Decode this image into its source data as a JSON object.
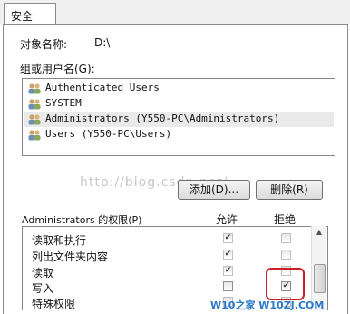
{
  "tab": {
    "label": "安全"
  },
  "object": {
    "label": "对象名称:",
    "value": "D:\\"
  },
  "group": {
    "label": "组或用户名(G):",
    "users": [
      {
        "name": "Authenticated Users",
        "selected": false
      },
      {
        "name": "SYSTEM",
        "selected": false
      },
      {
        "name": "Administrators (Y550-PC\\Administrators)",
        "selected": true
      },
      {
        "name": "Users (Y550-PC\\Users)",
        "selected": false
      }
    ],
    "icon": "users-icon"
  },
  "buttons": {
    "add": "添加(D)...",
    "remove": "删除(R)"
  },
  "permissions": {
    "label": "Administrators 的权限(P)",
    "allow_header": "允许",
    "deny_header": "拒绝",
    "rows": [
      {
        "name": "读取和执行",
        "allow": true,
        "deny": false
      },
      {
        "name": "列出文件夹内容",
        "allow": true,
        "deny": false
      },
      {
        "name": "读取",
        "allow": true,
        "deny": false
      },
      {
        "name": "写入",
        "allow": false,
        "deny": true
      },
      {
        "name": "特殊权限",
        "allow": false,
        "deny": false
      }
    ]
  },
  "watermarks": {
    "center": "http://blog.csdn.net/",
    "corner": "W10之家 W10ZJ.COM"
  },
  "colors": {
    "highlight": "#c8202a",
    "selection": "#eaeaea",
    "border": "#828790"
  }
}
